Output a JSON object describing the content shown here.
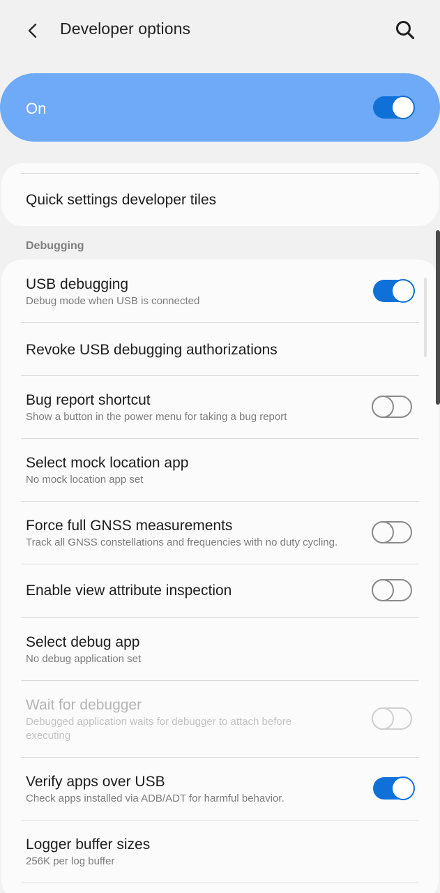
{
  "header": {
    "title": "Developer options",
    "back_icon": "chevron-left-icon",
    "search_icon": "search-icon"
  },
  "master_switch": {
    "label": "On",
    "state": true,
    "background_color": "#6eaaf7"
  },
  "quick_settings": {
    "label": "Quick settings developer tiles"
  },
  "debugging": {
    "section_label": "Debugging",
    "items": [
      {
        "title": "USB debugging",
        "subtitle": "Debug mode when USB is connected",
        "toggle": "on"
      },
      {
        "title": "Revoke USB debugging authorizations"
      },
      {
        "title": "Bug report shortcut",
        "subtitle": "Show a button in the power menu for taking a bug report",
        "toggle": "off"
      },
      {
        "title": "Select mock location app",
        "subtitle": "No mock location app set"
      },
      {
        "title": "Force full GNSS measurements",
        "subtitle": "Track all GNSS constellations and frequencies with no duty cycling.",
        "toggle": "off"
      },
      {
        "title": "Enable view attribute inspection",
        "toggle": "off"
      },
      {
        "title": "Select debug app",
        "subtitle": "No debug application set"
      },
      {
        "title": "Wait for debugger",
        "subtitle_line1": "Debugged application waits for debugger to attach before",
        "subtitle_line2": "executing",
        "toggle": "off",
        "disabled": true
      },
      {
        "title": "Verify apps over USB",
        "subtitle": "Check apps installed via ADB/ADT for harmful behavior.",
        "toggle": "on"
      },
      {
        "title": "Logger buffer sizes",
        "subtitle": "256K per log buffer"
      }
    ]
  },
  "colors": {
    "accent": "#0f70d8",
    "background": "#f1f1f1",
    "card": "#fbfbfb"
  }
}
